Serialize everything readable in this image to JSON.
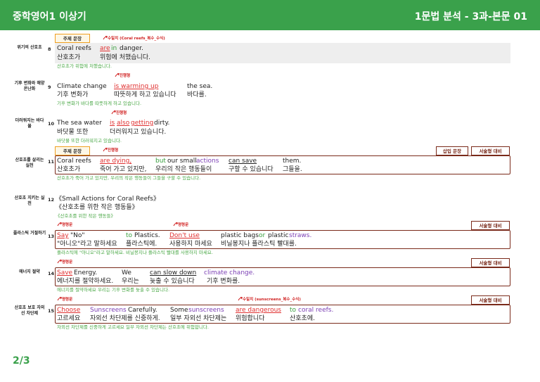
{
  "header": {
    "title": "중학영어1 이상기",
    "subtitle": "1문법 분석 - 3과-본문 01"
  },
  "tags": {
    "main": "주제 문장",
    "insert": "삽입 문장",
    "essay": "서술형 대비"
  },
  "page": "2/3",
  "rows": {
    "r8": {
      "topic": "위기의 산호초",
      "num": "8",
      "ann": "수일치 (Coral reefs_복수_수식)",
      "en": [
        "Coral reefs",
        "are",
        "in",
        "danger."
      ],
      "ko": [
        "산호초가",
        "위험에 처했습니다."
      ],
      "trans": "산호초가 위험에 처했습니다."
    },
    "r9": {
      "topic": "기후 변화와 해양 온난화",
      "num": "9",
      "ann": "진행형",
      "en": [
        "Climate change",
        "is warming up",
        "the sea."
      ],
      "ko": [
        "기후 변화가",
        "따뜻하게 하고 있습니다",
        "바다를."
      ],
      "trans": "기후 변화가 바다를 따뜻하게 하고 있습니다."
    },
    "r10": {
      "topic": "더러워지는 바다 물",
      "num": "10",
      "ann": "진행형",
      "en": [
        "The sea water",
        "is",
        "also",
        "getting",
        "dirty."
      ],
      "ko": [
        "바닷물 또한",
        "더러워지고 있습니다."
      ],
      "trans": "바닷물 또한 더러워지고 있습니다."
    },
    "r11": {
      "topic": "산호초를 살리는 실천",
      "num": "11",
      "ann": "진행형",
      "en": [
        "Coral reefs",
        "are dying,",
        "but",
        "our small",
        "actions",
        "can save",
        "them."
      ],
      "ko": [
        "산호초가",
        "죽어 가고 있지만,",
        "우리의 작은 행동들이",
        "구할 수 있습니다",
        "그들을."
      ],
      "trans": "산호초가 죽어 가고 있지만, 우리의 작은 행동들이 그들을 구할 수 있습니다."
    },
    "r12": {
      "topic": "산호초 지키는 실천",
      "num": "12",
      "en": "《Small Actions for Coral Reefs》",
      "ko": "《산호초를 위한 작은 행동들》",
      "trans": "《산호초를 위한 작은 행동들》"
    },
    "r13": {
      "topic": "플라스틱 거절하기",
      "num": "13",
      "ann1": "명령문",
      "ann2": "명령문",
      "en": [
        "Say",
        "\"No\"",
        "to",
        "Plastics.",
        "Don't use",
        "plastic bags",
        "or",
        "plastic",
        "straws."
      ],
      "ko": [
        "\"아니오\"라고 말하세요",
        "플라스틱에.",
        "사용하지 마세요",
        "비닐봉지나 플라스틱 빨대를."
      ],
      "trans": "플라스틱에 \"아니오\"라고 말하세요. 비닐봉지나 플라스틱 빨대를 사용하지 마세요."
    },
    "r14": {
      "topic": "에너지 절약",
      "num": "14",
      "ann": "명령문",
      "en": [
        "Save",
        "Energy.",
        "We",
        "can slow down",
        "climate change."
      ],
      "ko": [
        "에너지를 절약하세요.",
        "우리는",
        "늦출 수 있습니다",
        "기후 변화를."
      ],
      "trans": "에너지를 절약하세요 우리는 기후 변화를 늦출 수 있습니다."
    },
    "r15": {
      "topic": "산호초 보호 자외선 차단제",
      "num": "15",
      "ann1": "명령문",
      "ann2": "수일치 (sunscreens_복수_수식)",
      "en": [
        "Choose",
        "Sunscreens",
        "Carefully.",
        "Some",
        "sunscreens",
        "are dangerous",
        "to",
        "coral reefs."
      ],
      "ko": [
        "고르세요",
        "자외선 차단제를 신중하게.",
        "일부 자외선 차단제는",
        "위험합니다",
        "산호초에."
      ],
      "trans": "자외선 차단제를 신중하게 고르세요 일부 자외선 차단제는 산호초에 위험합니다."
    }
  },
  "colors": {
    "header": "#3aa14b",
    "translation": "#4aa846",
    "annotation": "#d02020",
    "verb": "#e03030",
    "connector": "#3aa040",
    "noun": "#7b3fb4",
    "box": "#7a2a1a"
  }
}
